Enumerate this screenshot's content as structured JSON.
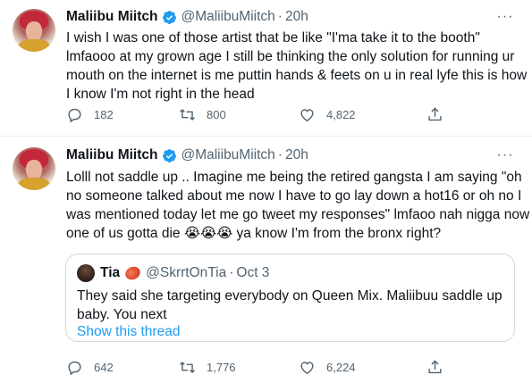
{
  "tweets": [
    {
      "author": {
        "name": "Maliibu Miitch",
        "handle": "@MaliibuMiitch",
        "time": "20h"
      },
      "text_lines": [
        "I wish I was one of those artist that be like \"I'ma take it to the booth\"",
        "lmfaooo at my grown age I still be thinking the only solution for running ur",
        "mouth on the internet is me puttin hands & feets on u in real lyfe this is how",
        "I know I'm not right in the head"
      ],
      "counts": {
        "replies": "182",
        "retweets": "800",
        "likes": "4,822"
      }
    },
    {
      "author": {
        "name": "Maliibu Miitch",
        "handle": "@MaliibuMiitch",
        "time": "20h"
      },
      "text_lines": [
        "Lolll not saddle up .. Imagine me being the retired gangsta I am saying \"oh",
        "no someone talked about me now I have to go lay down a hot16 or oh no I",
        "was mentioned today let me go tweet my responses\" lmfaoo nah nigga now",
        "one of us gotta die 😭😭😭 ya know I'm from the bronx right?"
      ],
      "quote": {
        "name": "Tia",
        "handle": "@SkrrtOnTia",
        "date": "Oct 3",
        "text_lines": [
          "They said she targeting everybody on Queen Mix. Maliibuu saddle up",
          "baby. You next"
        ],
        "show_thread": "Show this thread"
      },
      "counts": {
        "replies": "642",
        "retweets": "1,776",
        "likes": "6,224"
      }
    }
  ],
  "ui": {
    "dot": "·",
    "more": "···"
  },
  "icons": [
    "verified-badge-icon",
    "more-icon",
    "reply-icon",
    "retweet-icon",
    "like-icon",
    "share-icon",
    "basketball-emoji-icon"
  ],
  "colors": {
    "text": "#0f1419",
    "muted": "#536471",
    "link": "#1d9bf0",
    "border": "#cfd9de",
    "verified": "#1d9bf0"
  }
}
